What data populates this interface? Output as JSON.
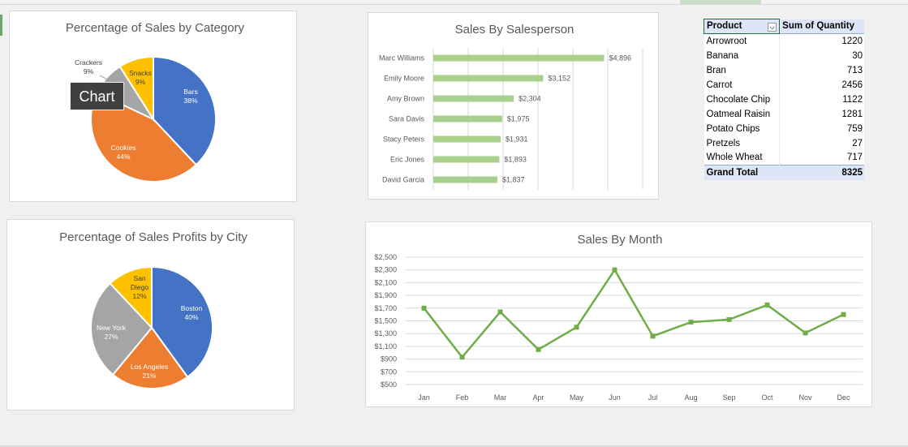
{
  "colors": {
    "blue": "#4472c4",
    "orange": "#ed7d31",
    "gray": "#a5a5a5",
    "gold": "#ffc000",
    "bar_green": "#a9d18e",
    "line_green": "#70ad47"
  },
  "tooltip": {
    "label": "Chart"
  },
  "pivot": {
    "header": {
      "product": "Product",
      "quantity": "Sum of Quantity"
    },
    "rows": [
      {
        "product": "Arrowroot",
        "quantity": "1220"
      },
      {
        "product": "Banana",
        "quantity": "30"
      },
      {
        "product": "Bran",
        "quantity": "713"
      },
      {
        "product": "Carrot",
        "quantity": "2456"
      },
      {
        "product": "Chocolate Chip",
        "quantity": "1122"
      },
      {
        "product": "Oatmeal Raisin",
        "quantity": "1281"
      },
      {
        "product": "Potato Chips",
        "quantity": "759"
      },
      {
        "product": "Pretzels",
        "quantity": "27"
      },
      {
        "product": "Whole Wheat",
        "quantity": "717"
      }
    ],
    "total": {
      "label": "Grand Total",
      "quantity": "8325"
    }
  },
  "chart_data": [
    {
      "type": "pie",
      "title": "Percentage of Sales by Category",
      "slices": [
        {
          "label": "Bars",
          "value": 38,
          "text": "38%",
          "color": "#4472c4"
        },
        {
          "label": "Cookies",
          "value": 44,
          "text": "44%",
          "color": "#ed7d31"
        },
        {
          "label": "Crackers",
          "value": 9,
          "text": "9%",
          "color": "#a5a5a5"
        },
        {
          "label": "Snacks",
          "value": 9,
          "text": "9%",
          "color": "#ffc000"
        }
      ]
    },
    {
      "type": "bar",
      "orientation": "horizontal",
      "title": "Sales By Salesperson",
      "categories": [
        "Marc Williams",
        "Emily Moore",
        "Amy Brown",
        "Sara Davis",
        "Stacy Peters",
        "Eric Jones",
        "David Garcia"
      ],
      "values": [
        4896,
        3152,
        2304,
        1975,
        1931,
        1893,
        1837
      ],
      "data_labels": [
        "$4,896",
        "$3,152",
        "$2,304",
        "$1,975",
        "$1,931",
        "$1,893",
        "$1,837"
      ],
      "xlim": [
        0,
        6000
      ],
      "grid": true
    },
    {
      "type": "pie",
      "title": "Percentage of Sales Profits by City",
      "slices": [
        {
          "label": "Boston",
          "value": 40,
          "text": "40%",
          "color": "#4472c4"
        },
        {
          "label": "Los Angeles",
          "value": 21,
          "text": "21%",
          "color": "#ed7d31"
        },
        {
          "label": "New York",
          "value": 27,
          "text": "27%",
          "color": "#a5a5a5"
        },
        {
          "label": "San Diego",
          "value": 12,
          "text": "12%",
          "color": "#ffc000"
        }
      ]
    },
    {
      "type": "line",
      "title": "Sales By Month",
      "categories": [
        "Jan",
        "Feb",
        "Mar",
        "Apr",
        "May",
        "Jun",
        "Jul",
        "Aug",
        "Sep",
        "Oct",
        "Nov",
        "Dec"
      ],
      "values": [
        1700,
        930,
        1640,
        1050,
        1400,
        2300,
        1260,
        1480,
        1520,
        1750,
        1310,
        1600
      ],
      "yticks": [
        "$500",
        "$700",
        "$900",
        "$1,100",
        "$1,300",
        "$1,500",
        "$1,700",
        "$1,900",
        "$2,100",
        "$2,300",
        "$2,500"
      ],
      "ylim": [
        500,
        2500
      ],
      "grid": true
    }
  ]
}
